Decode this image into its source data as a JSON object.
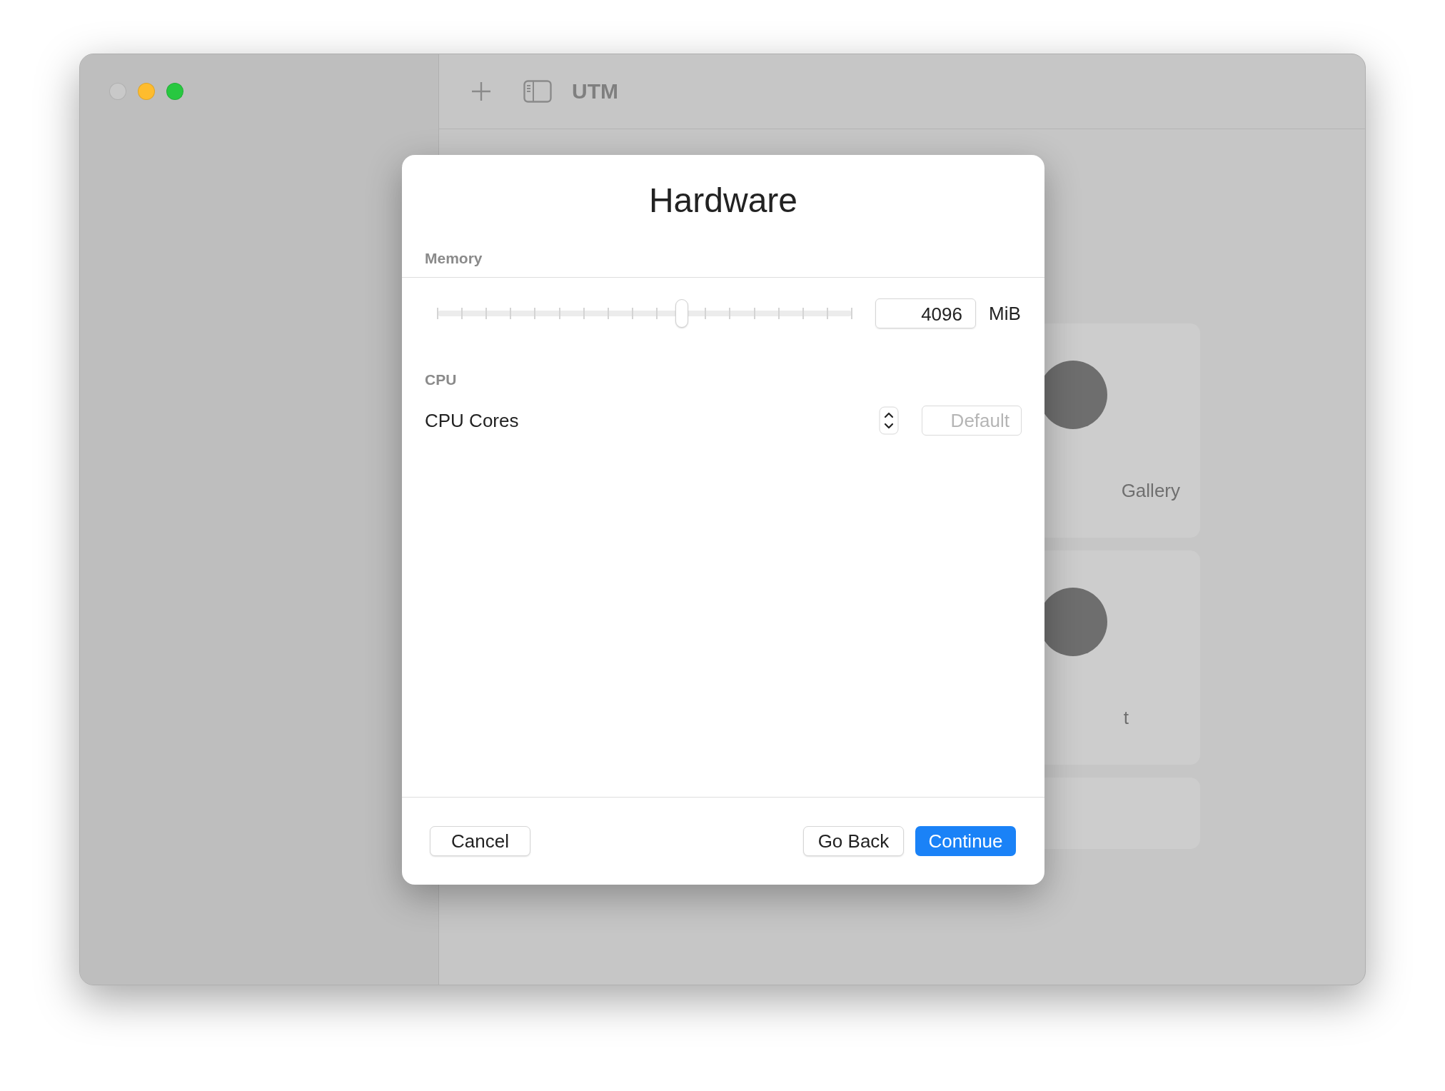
{
  "window": {
    "title": "UTM",
    "controls": [
      {
        "kind": "close",
        "disabled": true
      },
      {
        "kind": "minimize",
        "disabled": false
      },
      {
        "kind": "zoom",
        "disabled": false
      }
    ]
  },
  "background_cards": [
    {
      "label": "Gallery"
    },
    {
      "label": "t"
    }
  ],
  "dialog": {
    "title": "Hardware",
    "memory": {
      "heading": "Memory",
      "level": 0.59,
      "value": "4096",
      "unit": "MiB"
    },
    "cpu": {
      "heading": "CPU",
      "label": "CPU Cores",
      "placeholder": "Default"
    },
    "buttons": [
      {
        "label": "Cancel",
        "kind": "normal"
      },
      {
        "label": "Go Back",
        "kind": "normal"
      },
      {
        "label": "Continue",
        "kind": "primary"
      }
    ]
  }
}
